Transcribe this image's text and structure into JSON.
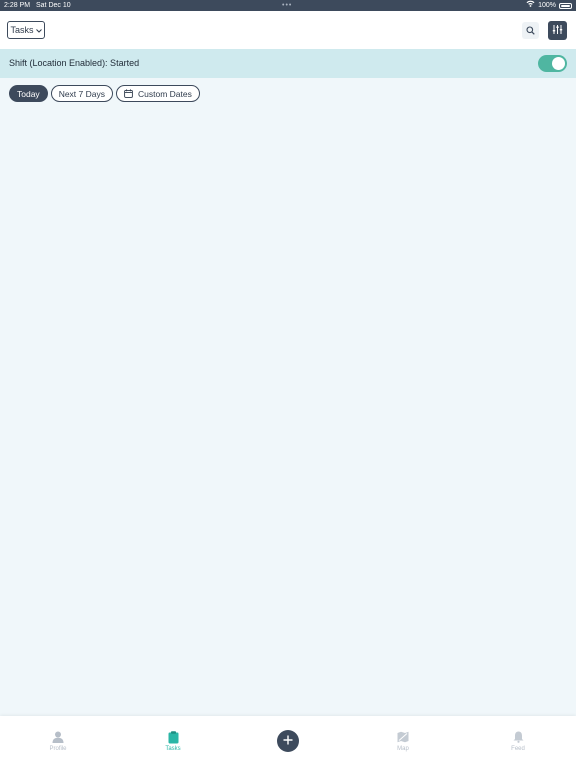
{
  "status_bar": {
    "time": "2:28 PM",
    "date": "Sat Dec 10",
    "dots": "•••",
    "battery": "100%"
  },
  "header": {
    "dropdown_label": "Tasks",
    "search_icon": "search-icon",
    "filter_icon": "sliders-icon"
  },
  "shift": {
    "label": "Shift (Location Enabled): Started",
    "toggle_on": true,
    "toggle_color": "#4fb6a1"
  },
  "filters": {
    "today": "Today",
    "next7": "Next 7 Days",
    "custom": "Custom Dates"
  },
  "tabbar": {
    "profile": "Profile",
    "tasks": "Tasks",
    "map": "Map",
    "feed": "Feed",
    "active_color": "#2bb6a6"
  }
}
